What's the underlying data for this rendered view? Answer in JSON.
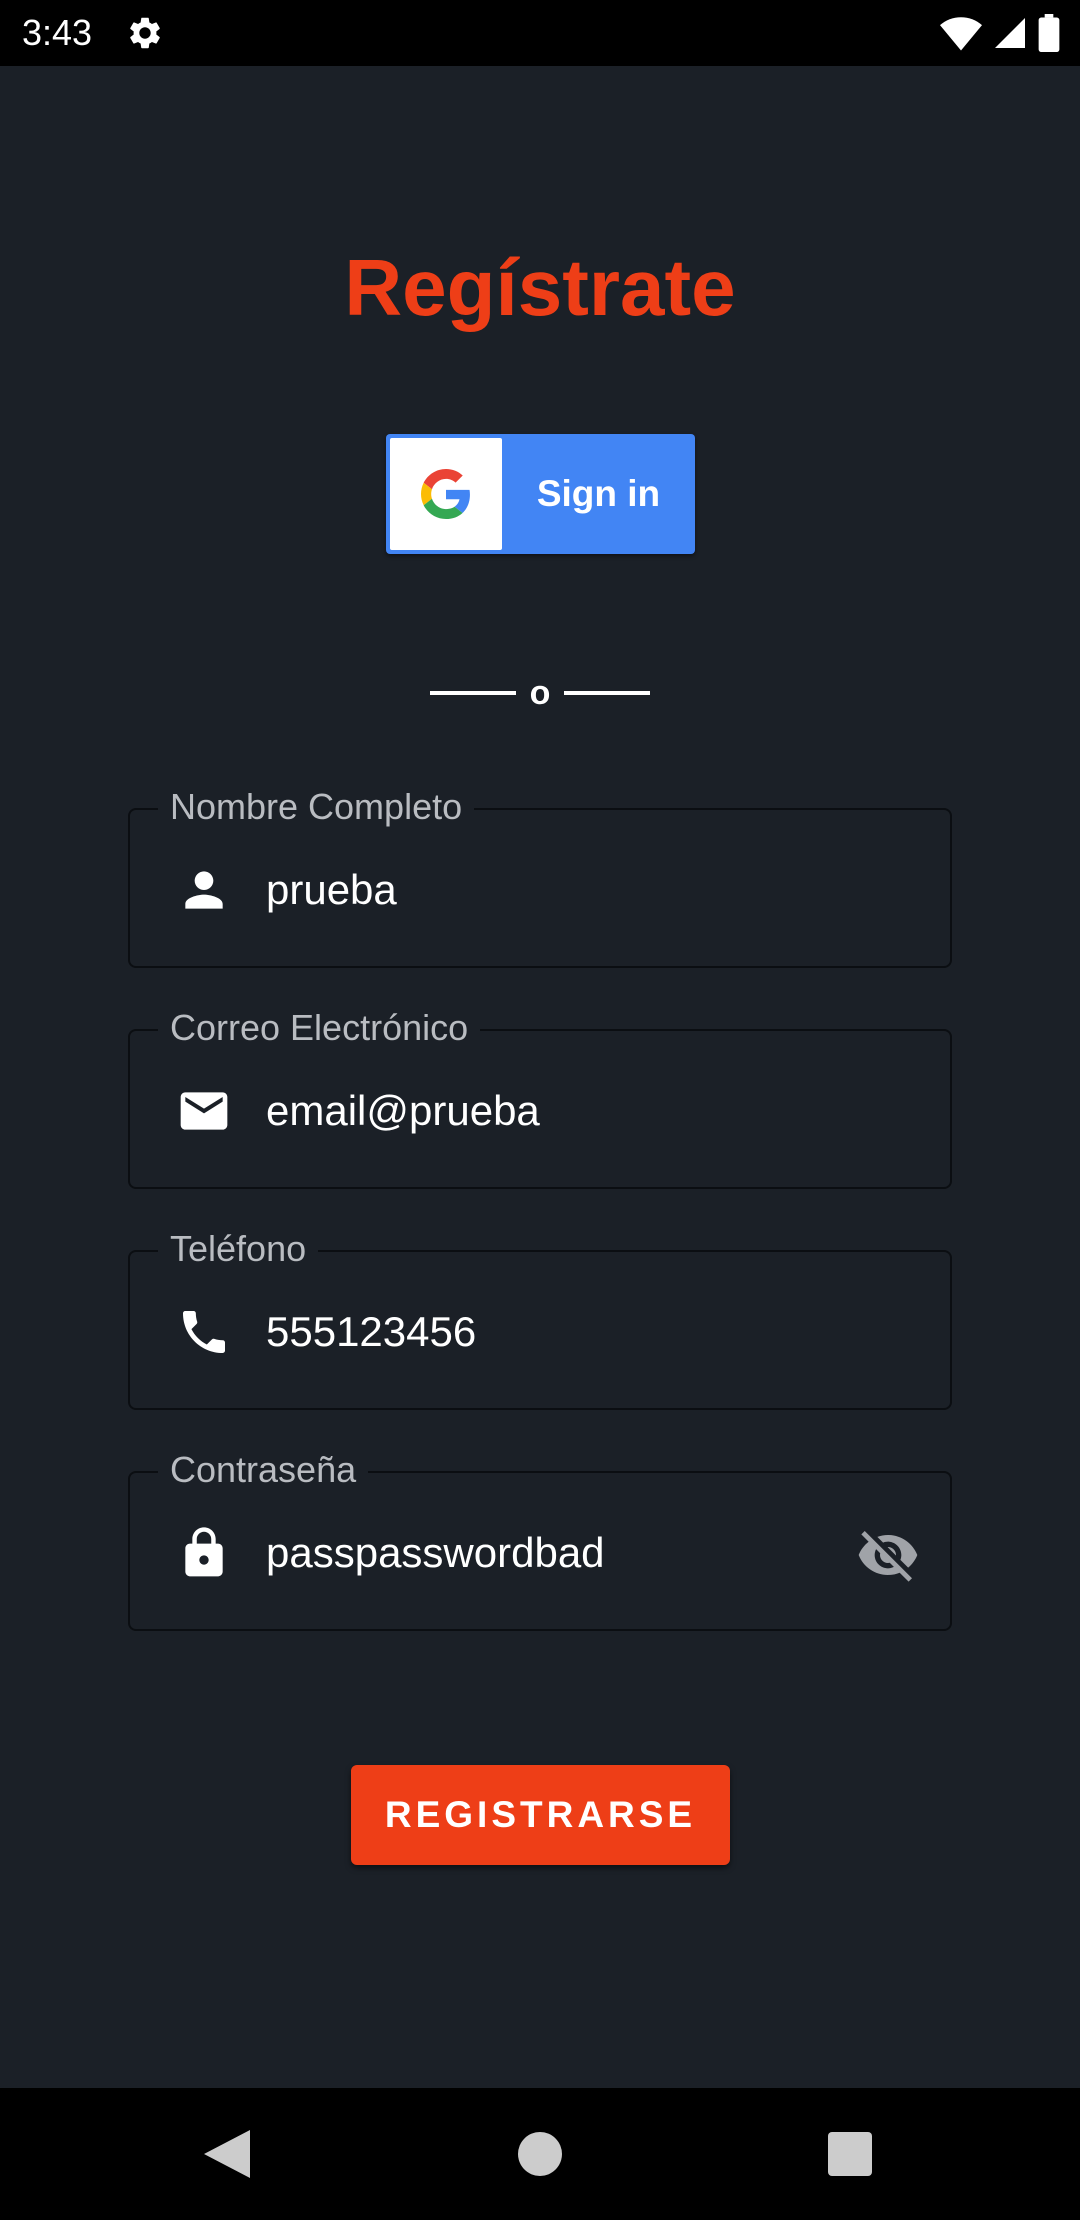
{
  "status_bar": {
    "time": "3:43",
    "icons": [
      "settings-gear-icon",
      "wifi-icon",
      "signal-icon",
      "battery-icon"
    ]
  },
  "title": "Regístrate",
  "google_button": {
    "label": "Sign in",
    "icon": "google-logo-icon"
  },
  "divider": {
    "text": "o"
  },
  "fields": [
    {
      "label": "Nombre Completo",
      "value": "prueba",
      "icon": "person-icon"
    },
    {
      "label": "Correo Electrónico",
      "value": "email@prueba",
      "icon": "mail-icon"
    },
    {
      "label": "Teléfono",
      "value": "555123456",
      "icon": "phone-icon"
    },
    {
      "label": "Contraseña",
      "value": "passpasswordbad",
      "icon": "lock-icon",
      "trailing_icon": "visibility-off-icon"
    }
  ],
  "register_button": {
    "label": "REGISTRARSE"
  },
  "nav_bar": {
    "items": [
      "back-icon",
      "home-icon",
      "recents-icon"
    ]
  },
  "colors": {
    "accent": "#ee3e17",
    "background": "#1b2027",
    "google_blue": "#4285f4"
  }
}
